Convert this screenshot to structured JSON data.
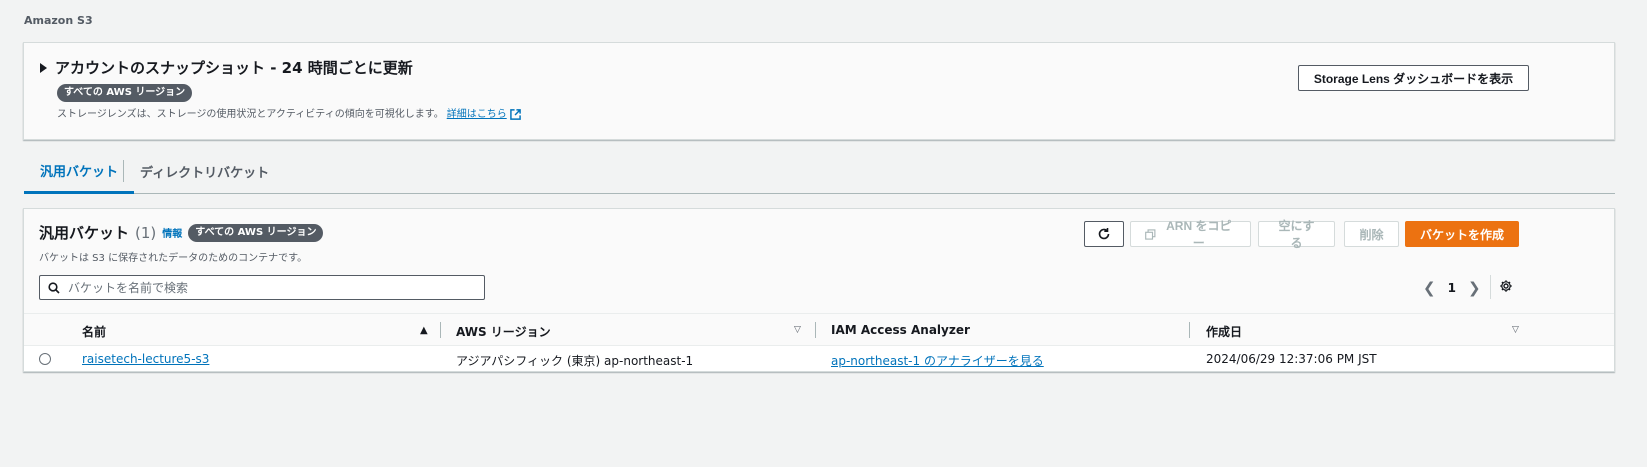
{
  "breadcrumb": "Amazon S3",
  "snapshot": {
    "title": "アカウントのスナップショット - 24 時間ごとに更新",
    "badge": "すべての AWS リージョン",
    "description": "ストレージレンズは、ストレージの使用状況とアクティビティの傾向を可視化します。",
    "link_label": "詳細はこちら",
    "dashboard_button": "Storage Lens ダッシュボードを表示"
  },
  "tabs": [
    {
      "label": "汎用バケット",
      "active": true
    },
    {
      "label": "ディレクトリバケット",
      "active": false
    }
  ],
  "buckets": {
    "title": "汎用バケット",
    "count": "(1)",
    "info_label": "情報",
    "region_badge": "すべての AWS リージョン",
    "description": "バケットは S3 に保存されたデータのためのコンテナです。",
    "search_placeholder": "バケットを名前で検索",
    "actions": {
      "copy_arn": "ARN をコピー",
      "empty": "空にする",
      "delete": "削除",
      "create": "バケットを作成"
    },
    "page": "1",
    "columns": [
      "名前",
      "AWS リージョン",
      "IAM Access Analyzer",
      "作成日"
    ],
    "rows": [
      {
        "name": "raisetech-lecture5-s3",
        "region": "アジアパシフィック (東京) ap-northeast-1",
        "analyzer": "ap-northeast-1 のアナライザーを見る",
        "created": "2024/06/29 12:37:06 PM JST"
      }
    ]
  },
  "colors": {
    "accent": "#0073bb",
    "primary_button": "#ec7211",
    "badge": "#545b64"
  }
}
